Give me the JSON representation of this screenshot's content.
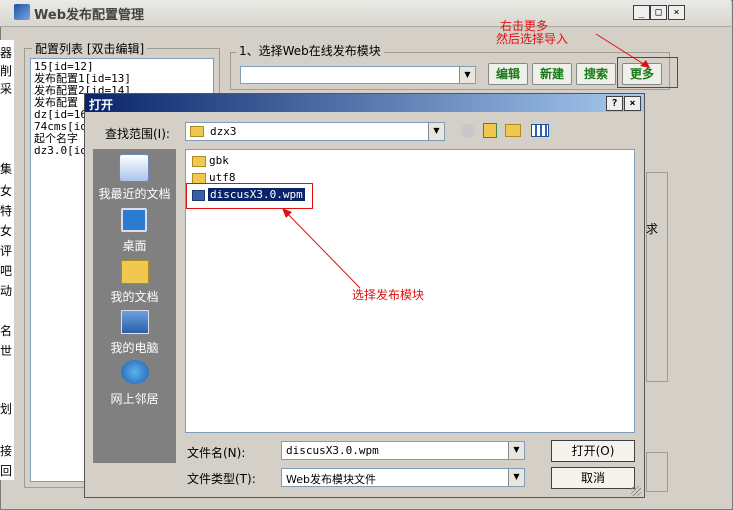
{
  "bg_window": {
    "title": "Web发布配置管理",
    "min_label": "_",
    "max_label": "□",
    "close_label": "×"
  },
  "config_list": {
    "label": "配置列表 [双击编辑]",
    "items": [
      "15[id=12]",
      "发布配置1[id=13]",
      "发布配置2[id=14]",
      "发布配置",
      "dz[id=16",
      "74cms[id",
      "起个名字",
      "dz3.0[id"
    ]
  },
  "module_group": {
    "label": "1、选择Web在线发布模块",
    "buttons": [
      "编辑",
      "新建",
      "搜索",
      "更多"
    ]
  },
  "left_cutoff_fragments": [
    "器",
    "削",
    "采",
    "集",
    "女",
    "特",
    "女",
    "评",
    "吧",
    "动",
    "名",
    "世",
    "划",
    "接",
    "回"
  ],
  "annotations": {
    "top": [
      "右击更多",
      "然后选择导入"
    ],
    "middle": "选择发布模块"
  },
  "dialog": {
    "title": "打开",
    "help_label": "?",
    "close_label": "×",
    "lookin_label": "查找范围(I):",
    "lookin_value": "dzx3",
    "places": [
      "我最近的文档",
      "桌面",
      "我的文档",
      "我的电脑",
      "网上邻居"
    ],
    "files": [
      {
        "name": "gbk",
        "type": "folder"
      },
      {
        "name": "utf8",
        "type": "folder"
      },
      {
        "name": "discusX3.0.wpm",
        "type": "file"
      }
    ],
    "filename_label": "文件名(N):",
    "filename_value": "discusX3.0.wpm",
    "filetype_label": "文件类型(T):",
    "filetype_value": "Web发布模块文件",
    "open_label": "打开(O)",
    "cancel_label": "取消"
  }
}
